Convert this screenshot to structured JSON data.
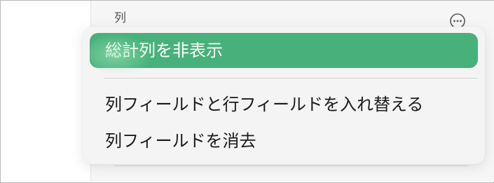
{
  "panel": {
    "section_label": "列",
    "more_icon": "ellipsis-circle-icon"
  },
  "menu": {
    "items": [
      {
        "label": "総計列を非表示",
        "highlighted": true
      },
      {
        "label": "列フィールドと行フィールドを入れ替える",
        "highlighted": false
      },
      {
        "label": "列フィールドを消去",
        "highlighted": false
      }
    ],
    "highlight_color": "#48b17b"
  }
}
